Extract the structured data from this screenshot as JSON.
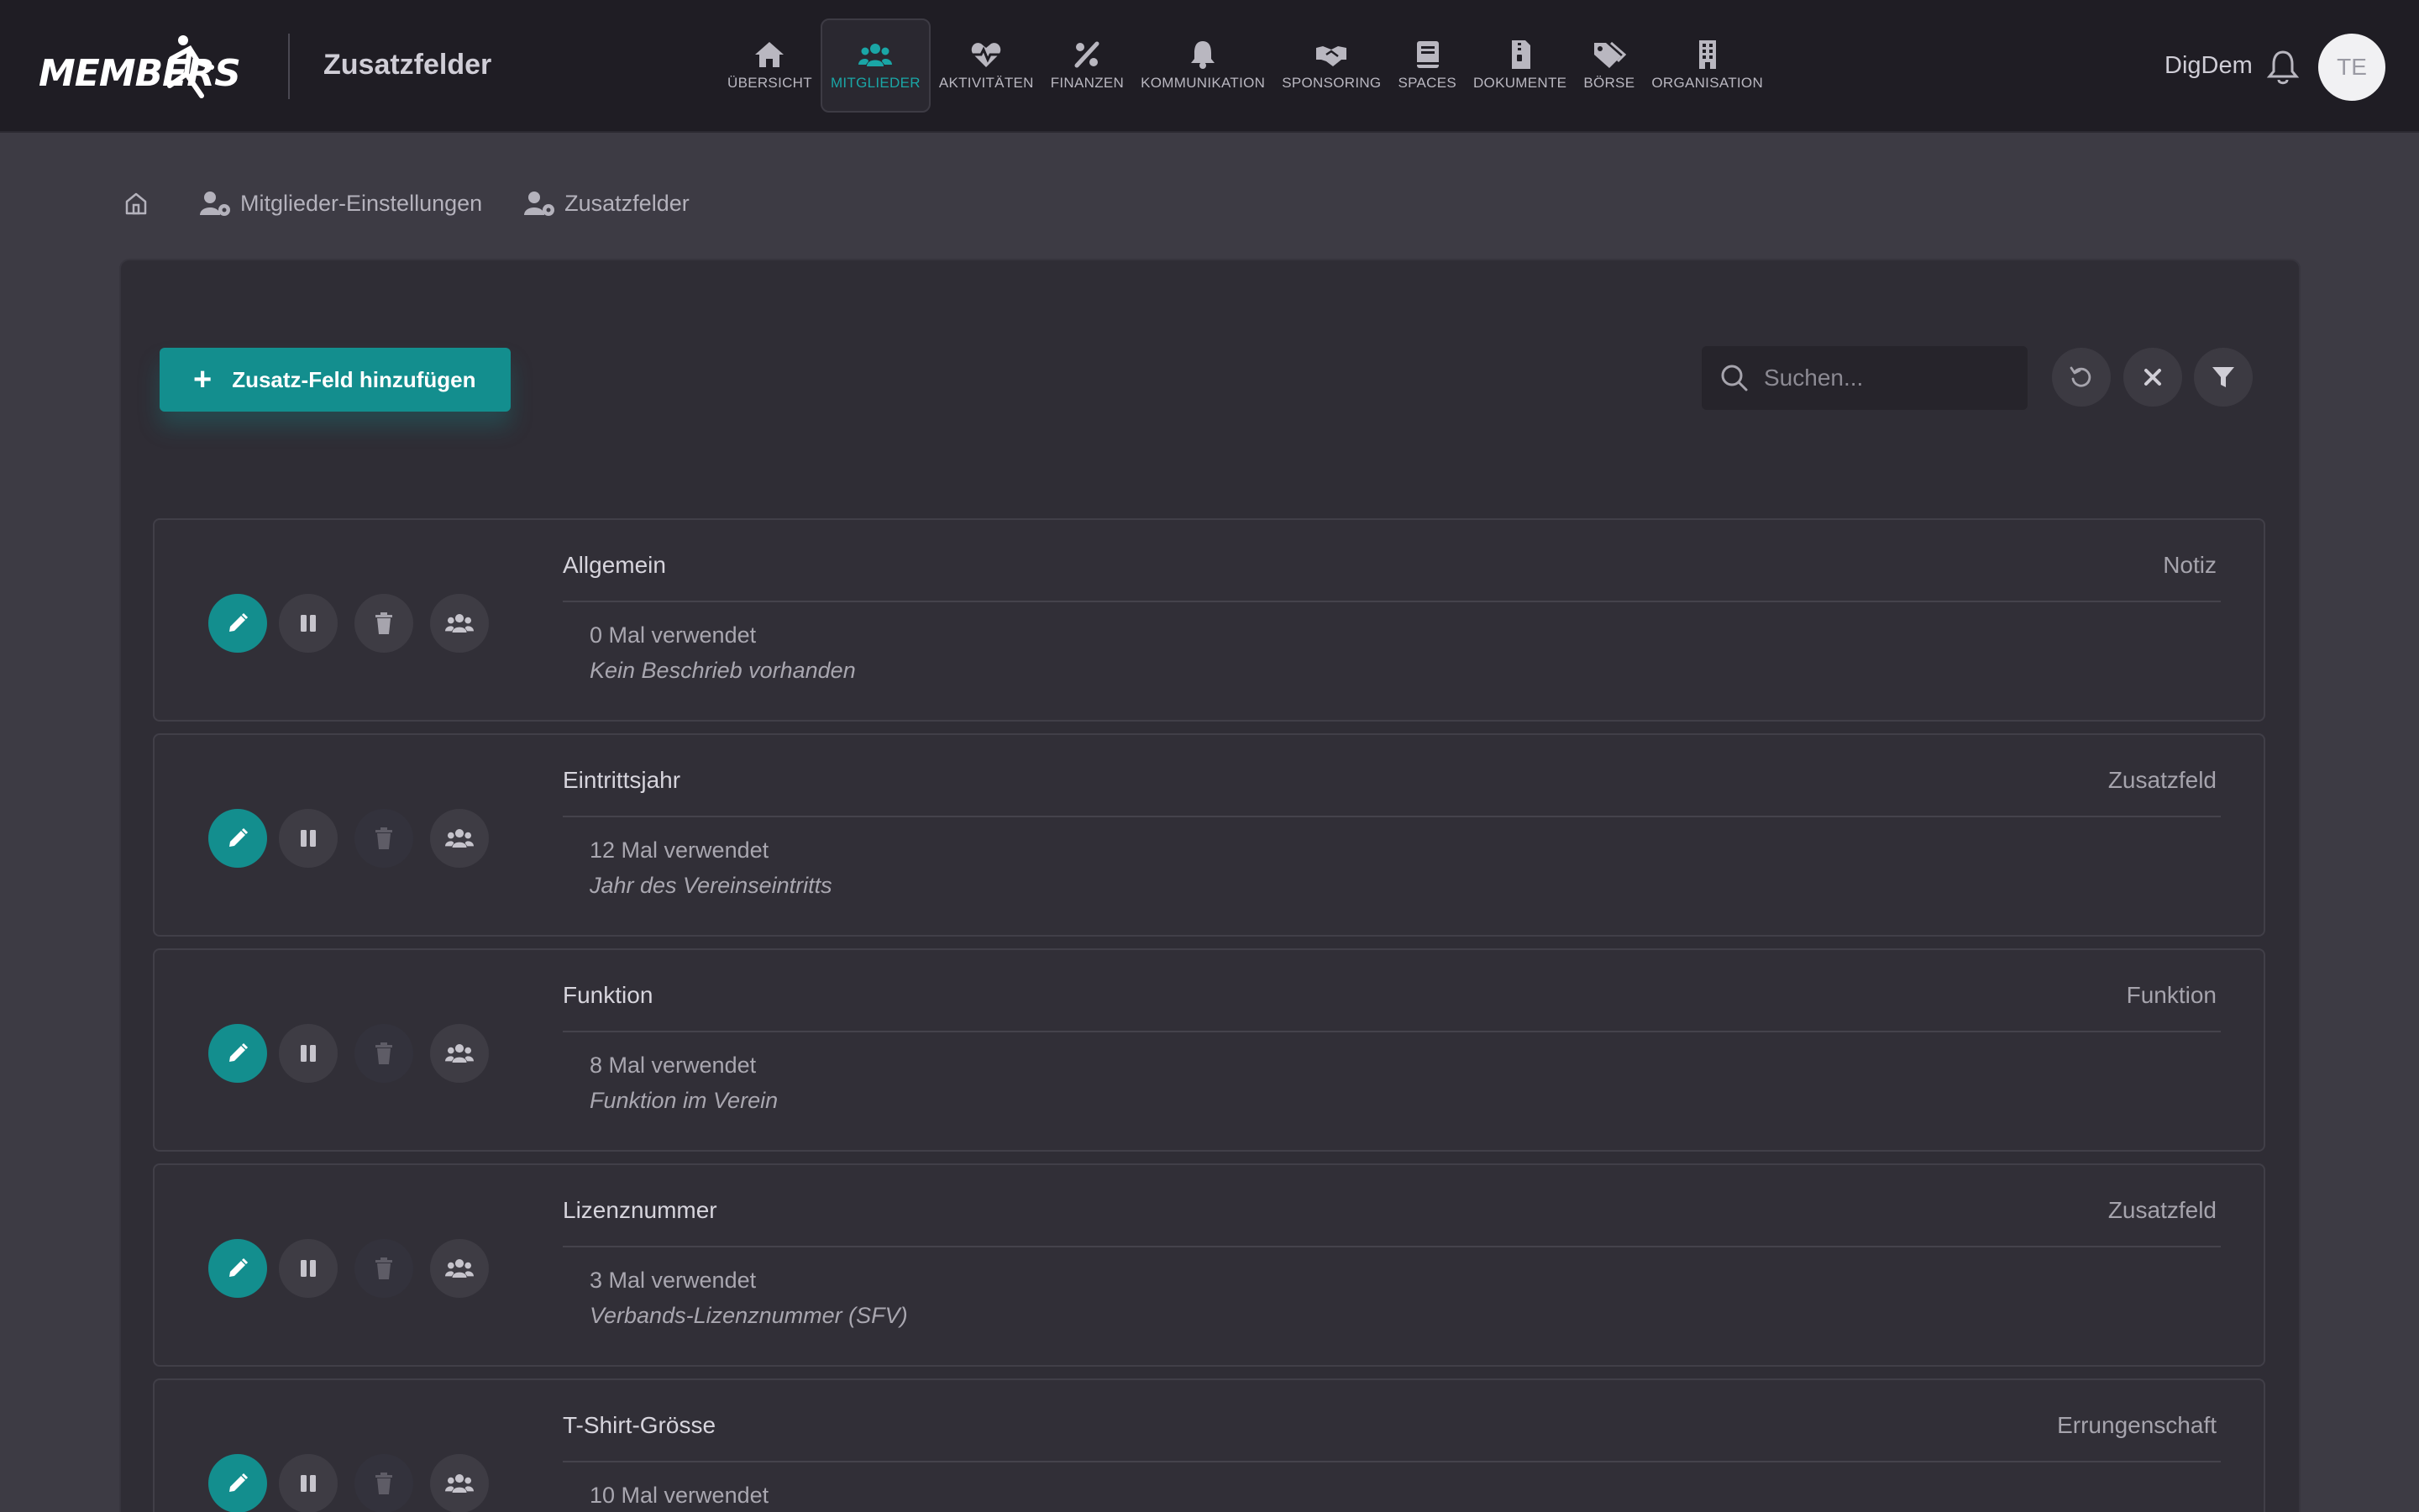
{
  "header": {
    "logo_text": "MEMBERS",
    "app_title": "Zusatzfelder",
    "user_name": "DigDem",
    "avatar_initials": "TE",
    "accent_color": "#1aa6a6"
  },
  "nav": [
    {
      "label": "ÜBERSICHT",
      "icon": "home-icon",
      "active": false
    },
    {
      "label": "MITGLIEDER",
      "icon": "users-icon",
      "active": true
    },
    {
      "label": "AKTIVITÄTEN",
      "icon": "heartbeat-icon",
      "active": false
    },
    {
      "label": "FINANZEN",
      "icon": "percent-icon",
      "active": false
    },
    {
      "label": "KOMMUNIKATION",
      "icon": "bell-icon",
      "active": false
    },
    {
      "label": "SPONSORING",
      "icon": "handshake-icon",
      "active": false
    },
    {
      "label": "SPACES",
      "icon": "book-icon",
      "active": false
    },
    {
      "label": "DOKUMENTE",
      "icon": "zip-file-icon",
      "active": false
    },
    {
      "label": "BÖRSE",
      "icon": "tags-icon",
      "active": false
    },
    {
      "label": "ORGANISATION",
      "icon": "building-icon",
      "active": false
    }
  ],
  "breadcrumb": [
    {
      "label": "",
      "icon": "home-icon"
    },
    {
      "label": "Mitglieder-Einstellungen",
      "icon": "user-cog-icon"
    },
    {
      "label": "Zusatzfelder",
      "icon": "user-cog-icon"
    }
  ],
  "toolbar": {
    "add_label": "Zusatz-Feld hinzufügen",
    "search_placeholder": "Suchen..."
  },
  "fields": [
    {
      "name": "Allgemein",
      "type": "Notiz",
      "usage": "0 Mal verwendet",
      "description": "Kein Beschrieb vorhanden",
      "deletable": true
    },
    {
      "name": "Eintrittsjahr",
      "type": "Zusatzfeld",
      "usage": "12 Mal verwendet",
      "description": "Jahr des Vereinseintritts",
      "deletable": false
    },
    {
      "name": "Funktion",
      "type": "Funktion",
      "usage": "8 Mal verwendet",
      "description": "Funktion im Verein",
      "deletable": false
    },
    {
      "name": "Lizenznummer",
      "type": "Zusatzfeld",
      "usage": "3 Mal verwendet",
      "description": "Verbands-Lizenznummer (SFV)",
      "deletable": false
    },
    {
      "name": "T-Shirt-Grösse",
      "type": "Errungenschaft",
      "usage": "10 Mal verwendet",
      "description": "",
      "deletable": false
    }
  ]
}
